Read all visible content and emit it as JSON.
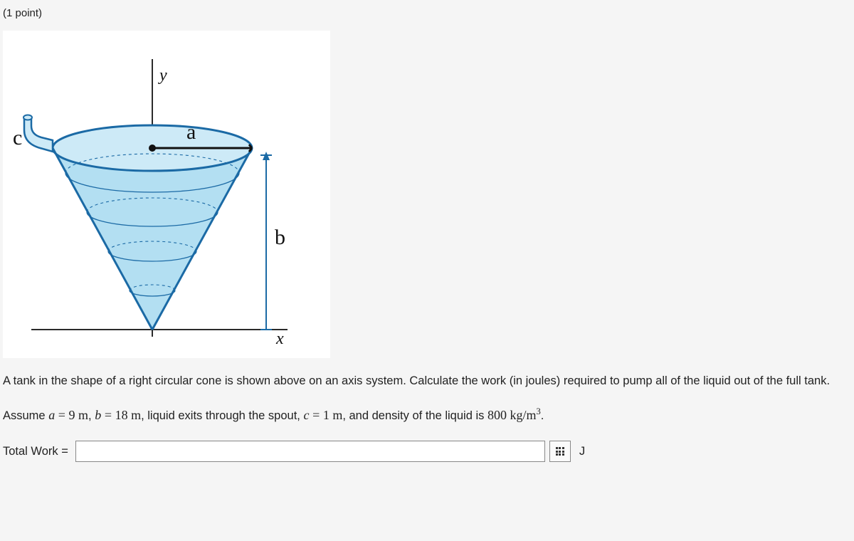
{
  "points": "(1 point)",
  "diagram": {
    "label_y": "y",
    "label_x": "x",
    "label_a": "a",
    "label_b": "b",
    "label_c": "c"
  },
  "problem_text": "A tank in the shape of a right circular cone is shown above on an axis system. Calculate the work (in joules) required to pump all of the liquid out of the full tank.",
  "assume": {
    "prefix": "Assume ",
    "a_var": "a",
    "a_val": "9 m",
    "b_var": "b",
    "b_val": "18 m",
    "mid": ", liquid exits through the spout, ",
    "c_var": "c",
    "c_val": "1 m",
    "dens_text": ", and density of the liquid is ",
    "dens_val": "800 kg/m",
    "dens_exp": "3",
    "period": "."
  },
  "answer": {
    "label": "Total Work =",
    "value": "",
    "unit": "J"
  }
}
